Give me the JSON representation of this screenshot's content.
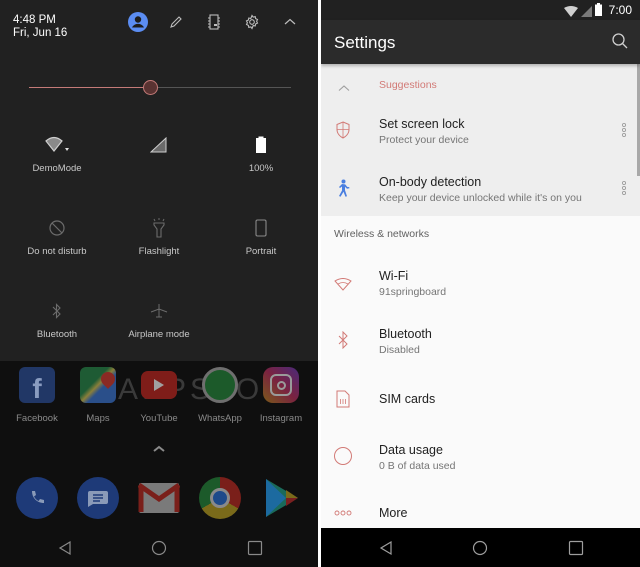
{
  "left_panel": {
    "quick_settings": {
      "time": "4:48 PM",
      "date": "Fri, Jun 16",
      "header_icons": [
        "user-avatar-icon",
        "edit-pencil-icon",
        "chip-icon",
        "settings-gear-icon",
        "chevron-up-icon"
      ],
      "brightness": {
        "level_percent": 46,
        "accent_color": "#c47a78"
      },
      "tiles": [
        {
          "label": "DemoMode",
          "icon": "wifi-icon",
          "active": true
        },
        {
          "label": "",
          "icon": "cellular-signal-icon",
          "active": true
        },
        {
          "label": "100%",
          "icon": "battery-icon",
          "active": true
        },
        {
          "label": "Do not disturb",
          "icon": "do-not-disturb-icon",
          "active": false
        },
        {
          "label": "Flashlight",
          "icon": "flashlight-icon",
          "active": false
        },
        {
          "label": "Portrait",
          "icon": "portrait-rotation-icon",
          "active": false
        },
        {
          "label": "Bluetooth",
          "icon": "bluetooth-icon",
          "active": false
        },
        {
          "label": "Airplane mode",
          "icon": "airplane-icon",
          "active": false
        }
      ]
    },
    "home": {
      "watermark": "APPSTOD",
      "apps": [
        {
          "label": "Facebook",
          "icon": "facebook-icon"
        },
        {
          "label": "Maps",
          "icon": "maps-icon"
        },
        {
          "label": "YouTube",
          "icon": "youtube-icon"
        },
        {
          "label": "WhatsApp",
          "icon": "whatsapp-icon"
        },
        {
          "label": "Instagram",
          "icon": "instagram-icon"
        }
      ],
      "dock": [
        "phone-icon",
        "messages-icon",
        "gmail-icon",
        "chrome-icon",
        "play-store-icon"
      ]
    },
    "nav": [
      "back-icon",
      "home-icon",
      "recents-icon"
    ]
  },
  "right_panel": {
    "status_bar": {
      "time": "7:00"
    },
    "app_bar": {
      "title": "Settings"
    },
    "suggestions": {
      "header": "Suggestions",
      "items": [
        {
          "title": "Set screen lock",
          "subtitle": "Protect your device",
          "icon": "shield-icon"
        },
        {
          "title": "On-body detection",
          "subtitle": "Keep your device unlocked while it's on you",
          "icon": "walking-person-icon"
        }
      ]
    },
    "section": "Wireless & networks",
    "items": [
      {
        "title": "Wi-Fi",
        "subtitle": "91springboard",
        "icon": "wifi-icon"
      },
      {
        "title": "Bluetooth",
        "subtitle": "Disabled",
        "icon": "bluetooth-icon"
      },
      {
        "title": "SIM cards",
        "subtitle": "",
        "icon": "sim-card-icon"
      },
      {
        "title": "Data usage",
        "subtitle": "0 B of data used",
        "icon": "data-usage-icon"
      },
      {
        "title": "More",
        "subtitle": "",
        "icon": "more-dots-icon"
      }
    ],
    "accent_color": "#d27a76"
  }
}
